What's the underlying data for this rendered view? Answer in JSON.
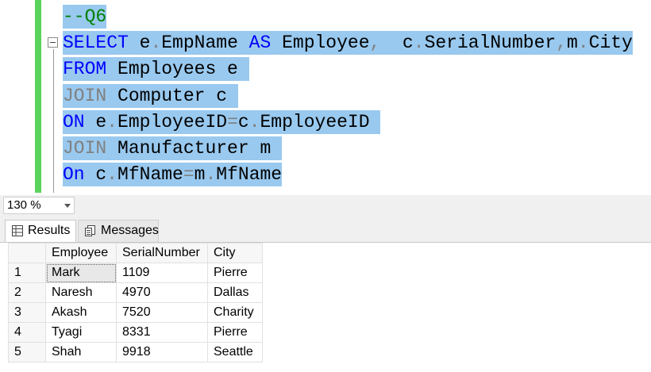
{
  "editor": {
    "line_comment": "--Q6",
    "line2": {
      "select": "SELECT",
      "t1": " e",
      "d1": ".",
      "t2": "EmpName ",
      "as": "AS",
      "t3": " Employee",
      "c1": ",",
      "t4": "  c",
      "d2": ".",
      "t5": "SerialNumber",
      "c2": ",",
      "t6": "m",
      "d3": ".",
      "t7": "City"
    },
    "line3": {
      "from": "FROM",
      "t1": " Employees e "
    },
    "line4": {
      "join": "JOIN",
      "t1": " Computer c "
    },
    "line5": {
      "on": "ON",
      "t1": " e",
      "d1": ".",
      "t2": "EmployeeID",
      "eq": "=",
      "t3": "c",
      "d2": ".",
      "t4": "EmployeeID "
    },
    "line6": {
      "join": "JOIN",
      "t1": " Manufacturer m "
    },
    "line7": {
      "on": "On",
      "t1": " c",
      "d1": ".",
      "t2": "MfName",
      "eq": "=",
      "t3": "m",
      "d2": ".",
      "t4": "MfName"
    }
  },
  "zoom": {
    "value": "130 %"
  },
  "tabs": {
    "results": "Results",
    "messages": "Messages"
  },
  "grid": {
    "columns": [
      "Employee",
      "SerialNumber",
      "City"
    ],
    "rows": [
      {
        "num": "1",
        "employee": "Mark",
        "serial": "1109",
        "city": "Pierre"
      },
      {
        "num": "2",
        "employee": "Naresh",
        "serial": "4970",
        "city": "Dallas"
      },
      {
        "num": "3",
        "employee": "Akash",
        "serial": "7520",
        "city": "Charity"
      },
      {
        "num": "4",
        "employee": "Tyagi",
        "serial": "8331",
        "city": "Pierre"
      },
      {
        "num": "5",
        "employee": "Shah",
        "serial": "9918",
        "city": "Seattle"
      }
    ]
  },
  "colors": {
    "selection": "#99c9ef",
    "keyword": "#0000ff",
    "comment": "#008000",
    "change_bar": "#5bd25b"
  }
}
